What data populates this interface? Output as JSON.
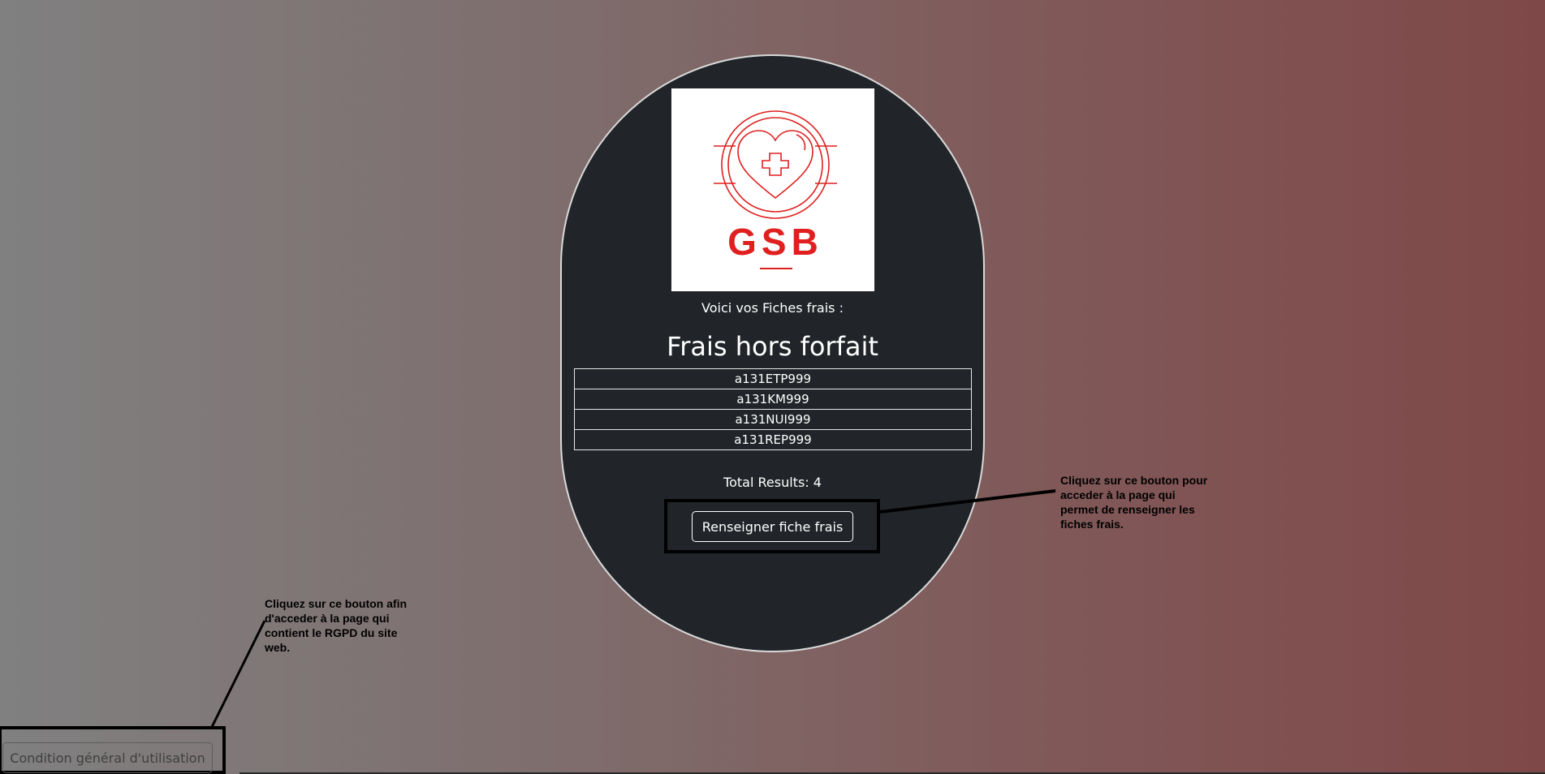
{
  "logo": {
    "brand_text": "GSB",
    "icon": "heart-cross-icon",
    "accent_color": "#e01f1f"
  },
  "intro_text": "Voici vos Fiches frais :",
  "section_title": "Frais hors forfait",
  "fiches": [
    "a131ETP999",
    "a131KM999",
    "a131NUI999",
    "a131REP999"
  ],
  "total_results": "Total Results: 4",
  "renseigner_button_label": "Renseigner fiche frais",
  "annotations": {
    "right": [
      "Cliquez sur ce bouton pour",
      "acceder à la page qui",
      "permet de renseigner les",
      "fiches frais."
    ],
    "left": [
      "Cliquez sur ce bouton afin",
      "d'acceder à la page qui",
      "contient le RGPD du site",
      "web."
    ]
  },
  "cgu_button_label": "Condition général d'utilisation",
  "colors": {
    "card_background": "#212529",
    "card_border": "#d9d9d9",
    "gradient_left": "#808080",
    "gradient_right": "#7f4848"
  }
}
